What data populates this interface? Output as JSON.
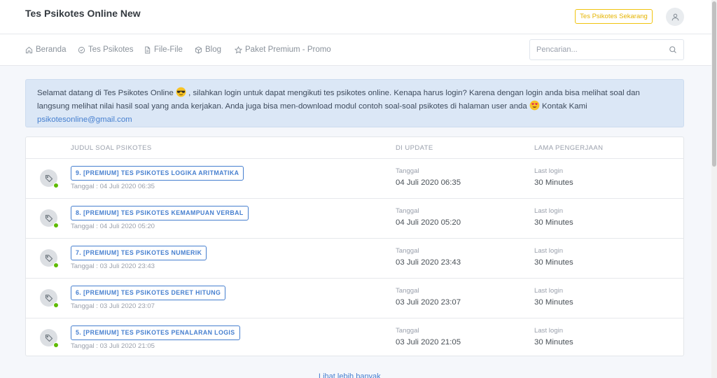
{
  "header": {
    "brand": "Tes Psikotes Online New",
    "cta_label": "Tes Psikotes Sekarang"
  },
  "nav": {
    "items": [
      {
        "label": "Beranda",
        "icon": "home-icon"
      },
      {
        "label": "Tes Psikotes",
        "icon": "check-circle-icon"
      },
      {
        "label": "File-File",
        "icon": "file-icon"
      },
      {
        "label": "Blog",
        "icon": "box-icon"
      },
      {
        "label": "Paket Premium - Promo",
        "icon": "star-icon"
      }
    ],
    "search_placeholder": "Pencarian..."
  },
  "alert": {
    "text_1": "Selamat datang di Tes Psikotes Online",
    "text_2": ", silahkan login untuk dapat mengikuti tes psikotes online. Kenapa harus login? Karena dengan login anda bisa melihat soal dan langsung melihat nilai hasil soal yang anda kerjakan. Anda juga bisa men-download modul contoh soal-soal psikotes di halaman user anda",
    "text_3": "Kontak Kami",
    "email": "psikotesonline@gmail.com"
  },
  "table": {
    "headers": {
      "title": "Judul Soal Psikotes",
      "updated": "Di Update",
      "duration": "Lama Pengerjaan"
    },
    "rows": [
      {
        "title": "9. [PREMIUM] Tes Psikotes Logika Aritmatika",
        "date_line": "Tanggal : 04 Juli 2020 06:35",
        "update_label": "Tanggal",
        "update_value": "04 Juli 2020 06:35",
        "duration_label": "Last login",
        "duration_value": "30 Minutes"
      },
      {
        "title": "8. [PREMIUM] Tes Psikotes Kemampuan Verbal",
        "date_line": "Tanggal : 04 Juli 2020 05:20",
        "update_label": "Tanggal",
        "update_value": "04 Juli 2020 05:20",
        "duration_label": "Last login",
        "duration_value": "30 Minutes"
      },
      {
        "title": "7. [PREMIUM] Tes Psikotes Numerik",
        "date_line": "Tanggal : 03 Juli 2020 23:43",
        "update_label": "Tanggal",
        "update_value": "03 Juli 2020 23:43",
        "duration_label": "Last login",
        "duration_value": "30 Minutes"
      },
      {
        "title": "6. [PREMIUM] Tes Psikotes Deret Hitung",
        "date_line": "Tanggal : 03 Juli 2020 23:07",
        "update_label": "Tanggal",
        "update_value": "03 Juli 2020 23:07",
        "duration_label": "Last login",
        "duration_value": "30 Minutes"
      },
      {
        "title": "5. [PREMIUM] Tes Psikotes Penalaran Logis",
        "date_line": "Tanggal : 03 Juli 2020 21:05",
        "update_label": "Tanggal",
        "update_value": "03 Juli 2020 21:05",
        "duration_label": "Last login",
        "duration_value": "30 Minutes"
      }
    ]
  },
  "footer": {
    "more_link": "Lihat lebih banyak"
  },
  "colors": {
    "accent": "#467fcf",
    "cta": "#f1c40f",
    "online": "#5eba00",
    "alert_bg": "#dbe7f6"
  }
}
